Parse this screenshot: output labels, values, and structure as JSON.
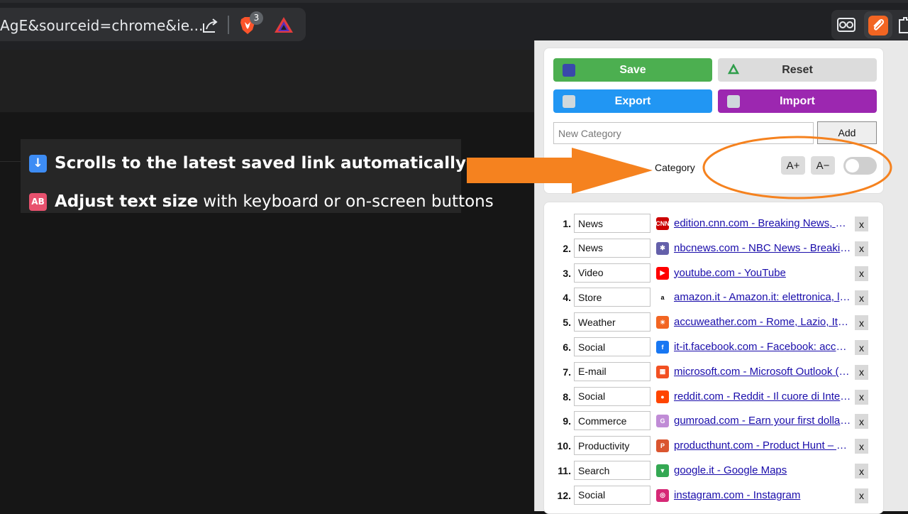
{
  "browser": {
    "url_text": "AgE&sourceid=chrome&ie...",
    "brave_badge": "3",
    "icons": [
      "share-icon",
      "brave-shield-icon",
      "brave-rewards-icon",
      "extension-icon",
      "clip-extension-icon",
      "puzzle-icon"
    ]
  },
  "callout": {
    "features": [
      {
        "icon": "down-arrow-emoji",
        "bold": "Scrolls to the latest saved link automatically",
        "rest": ""
      },
      {
        "icon": "ab-emoji",
        "emoji_text": "AB",
        "bold": "Adjust text size",
        "rest": "with keyboard or on-screen buttons"
      }
    ]
  },
  "popup": {
    "buttons": {
      "save": "Save",
      "reset": "Reset",
      "export": "Export",
      "import": "Import"
    },
    "new_category_placeholder": "New Category",
    "add_label": "Add",
    "category_label": "Category",
    "size_plus": "A+",
    "size_minus": "A−",
    "toggle_on": false,
    "links": [
      {
        "num": "1.",
        "category": "News",
        "fav": "CNN",
        "fav_color": "#cc0000",
        "text": "edition.cnn.com - Breaking News, Latest News and Videos"
      },
      {
        "num": "2.",
        "category": "News",
        "fav": "nbc-peacock-icon",
        "fav_color": "#6460aa",
        "text": "nbcnews.com - NBC News - Breaking News & Top Stories"
      },
      {
        "num": "3.",
        "category": "Video",
        "fav": "youtube-icon",
        "fav_color": "#ff0000",
        "text": "youtube.com - YouTube"
      },
      {
        "num": "4.",
        "category": "Store",
        "fav": "a",
        "fav_color": "#ffffff",
        "text": "amazon.it - Amazon.it: elettronica, libri, musica, moda"
      },
      {
        "num": "5.",
        "category": "Weather",
        "fav": "sun-icon",
        "fav_color": "#f26522",
        "text": "accuweather.com - Rome, Lazio, Italy Weather"
      },
      {
        "num": "6.",
        "category": "Social",
        "fav": "f",
        "fav_color": "#1877f2",
        "text": "it-it.facebook.com - Facebook: accedi o iscriviti"
      },
      {
        "num": "7.",
        "category": "E-mail",
        "fav": "windows-icon",
        "fav_color": "#f25022",
        "text": "microsoft.com - Microsoft Outlook (precedentemente Hotmail)"
      },
      {
        "num": "8.",
        "category": "Social",
        "fav": "reddit-icon",
        "fav_color": "#ff4500",
        "text": "reddit.com - Reddit - Il cuore di Internet"
      },
      {
        "num": "9.",
        "category": "Commerce",
        "fav": "G",
        "fav_color": "#c08cd6",
        "text": "gumroad.com - Earn your first dollar online"
      },
      {
        "num": "10.",
        "category": "Productivity",
        "fav": "P",
        "fav_color": "#da552f",
        "text": "producthunt.com - Product Hunt – The best new products"
      },
      {
        "num": "11.",
        "category": "Search",
        "fav": "maps-pin-icon",
        "fav_color": "#34a853",
        "text": "google.it - Google Maps"
      },
      {
        "num": "12.",
        "category": "Social",
        "fav": "instagram-icon",
        "fav_color": "#d62976",
        "text": "instagram.com - Instagram"
      }
    ],
    "remove_label": "x"
  },
  "annotation": {
    "arrow_color": "#f5821f",
    "circle_color": "#f5821f"
  }
}
